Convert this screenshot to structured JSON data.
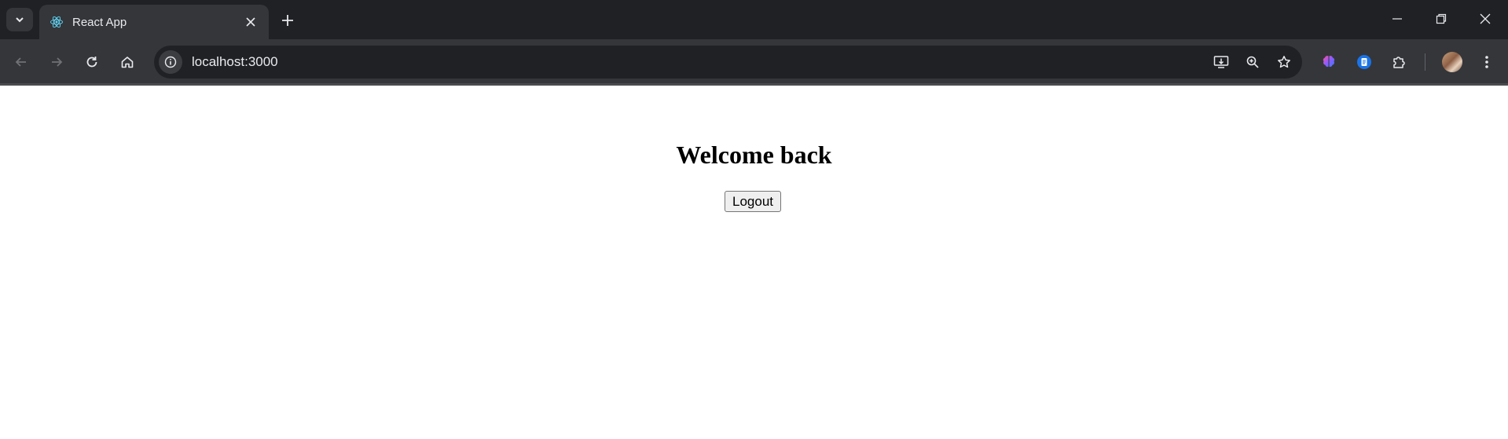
{
  "browser": {
    "tab": {
      "title": "React App",
      "favicon": "react-logo-icon"
    },
    "address_bar": {
      "url": "localhost:3000"
    },
    "colors": {
      "frame": "#202124",
      "toolbar": "#35363a",
      "react_blue": "#61dafb"
    }
  },
  "page": {
    "heading": "Welcome back",
    "logout_label": "Logout"
  }
}
